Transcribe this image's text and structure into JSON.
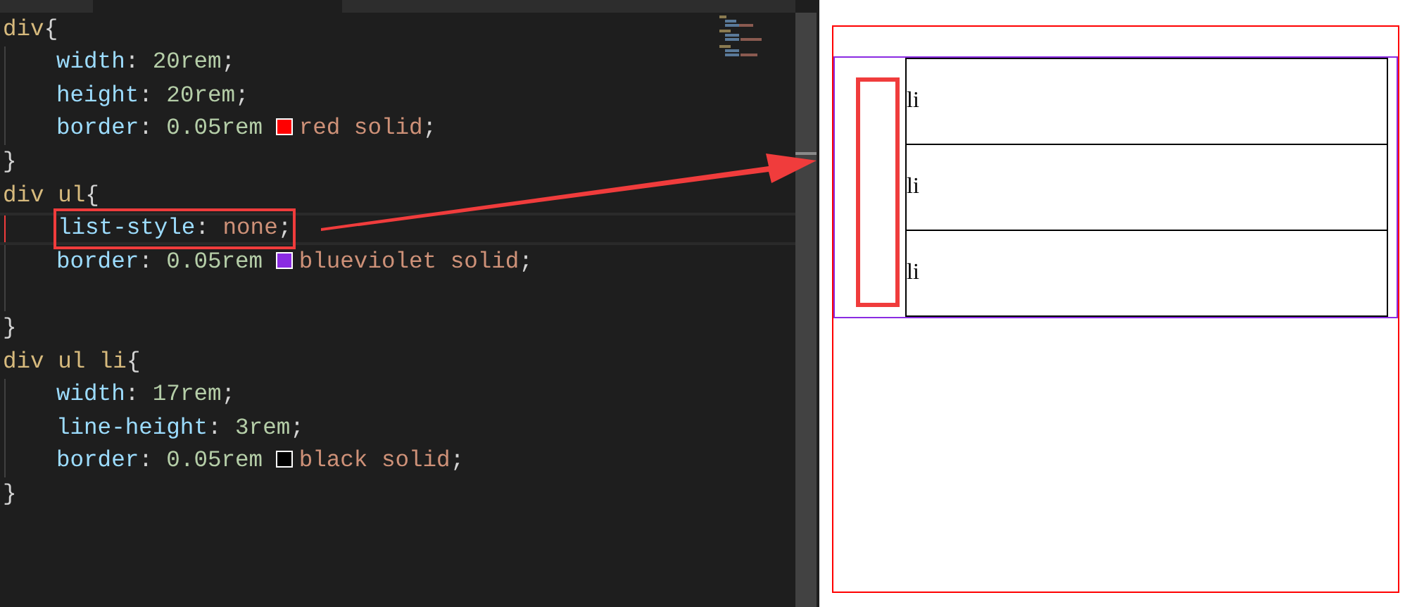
{
  "editor": {
    "lines": [
      {
        "kind": "selector",
        "annotated": false,
        "tokens": [
          {
            "kind": "selector",
            "text": "div"
          },
          {
            "kind": "punct",
            "text": "{"
          }
        ]
      },
      {
        "kind": "declaration",
        "annotated": false,
        "tokens": [
          {
            "kind": "property",
            "text": "width"
          },
          {
            "kind": "punct",
            "text": ": "
          },
          {
            "kind": "number",
            "text": "20rem"
          },
          {
            "kind": "punct",
            "text": ";"
          }
        ]
      },
      {
        "kind": "declaration",
        "annotated": false,
        "tokens": [
          {
            "kind": "property",
            "text": "height"
          },
          {
            "kind": "punct",
            "text": ": "
          },
          {
            "kind": "number",
            "text": "20rem"
          },
          {
            "kind": "punct",
            "text": ";"
          }
        ]
      },
      {
        "kind": "declaration",
        "annotated": false,
        "tokens": [
          {
            "kind": "property",
            "text": "border"
          },
          {
            "kind": "punct",
            "text": ": "
          },
          {
            "kind": "number",
            "text": "0.05rem "
          },
          {
            "kind": "swatch",
            "color": "#ff0000"
          },
          {
            "kind": "value",
            "text": "red solid"
          },
          {
            "kind": "punct",
            "text": ";"
          }
        ]
      },
      {
        "kind": "close",
        "annotated": false,
        "tokens": [
          {
            "kind": "punct",
            "text": "}"
          }
        ]
      },
      {
        "kind": "selector",
        "annotated": false,
        "tokens": [
          {
            "kind": "selector",
            "text": "div ul"
          },
          {
            "kind": "punct",
            "text": "{"
          }
        ]
      },
      {
        "kind": "declaration",
        "annotated": true,
        "tokens": [
          {
            "kind": "property",
            "text": "list-style"
          },
          {
            "kind": "punct",
            "text": ": "
          },
          {
            "kind": "value",
            "text": "none"
          },
          {
            "kind": "punct",
            "text": ";"
          }
        ]
      },
      {
        "kind": "declaration",
        "annotated": false,
        "tokens": [
          {
            "kind": "property",
            "text": "border"
          },
          {
            "kind": "punct",
            "text": ": "
          },
          {
            "kind": "number",
            "text": "0.05rem "
          },
          {
            "kind": "swatch",
            "color": "#8a2be2"
          },
          {
            "kind": "value",
            "text": "blueviolet solid"
          },
          {
            "kind": "punct",
            "text": ";"
          }
        ]
      },
      {
        "kind": "blank",
        "annotated": false
      },
      {
        "kind": "close",
        "annotated": false,
        "tokens": [
          {
            "kind": "punct",
            "text": "}"
          }
        ]
      },
      {
        "kind": "selector",
        "annotated": false,
        "tokens": [
          {
            "kind": "selector",
            "text": "div ul li"
          },
          {
            "kind": "punct",
            "text": "{"
          }
        ]
      },
      {
        "kind": "declaration",
        "annotated": false,
        "tokens": [
          {
            "kind": "property",
            "text": "width"
          },
          {
            "kind": "punct",
            "text": ": "
          },
          {
            "kind": "number",
            "text": "17rem"
          },
          {
            "kind": "punct",
            "text": ";"
          }
        ]
      },
      {
        "kind": "declaration",
        "annotated": false,
        "tokens": [
          {
            "kind": "property",
            "text": "line-height"
          },
          {
            "kind": "punct",
            "text": ": "
          },
          {
            "kind": "number",
            "text": "3rem"
          },
          {
            "kind": "punct",
            "text": ";"
          }
        ]
      },
      {
        "kind": "declaration",
        "annotated": false,
        "tokens": [
          {
            "kind": "property",
            "text": "border"
          },
          {
            "kind": "punct",
            "text": ": "
          },
          {
            "kind": "number",
            "text": "0.05rem "
          },
          {
            "kind": "swatch",
            "color": "#000000"
          },
          {
            "kind": "value",
            "text": "black solid"
          },
          {
            "kind": "punct",
            "text": ";"
          }
        ]
      },
      {
        "kind": "close",
        "annotated": false,
        "tokens": [
          {
            "kind": "punct",
            "text": "}"
          }
        ]
      }
    ]
  },
  "preview": {
    "items": [
      "li",
      "li",
      "li"
    ]
  }
}
